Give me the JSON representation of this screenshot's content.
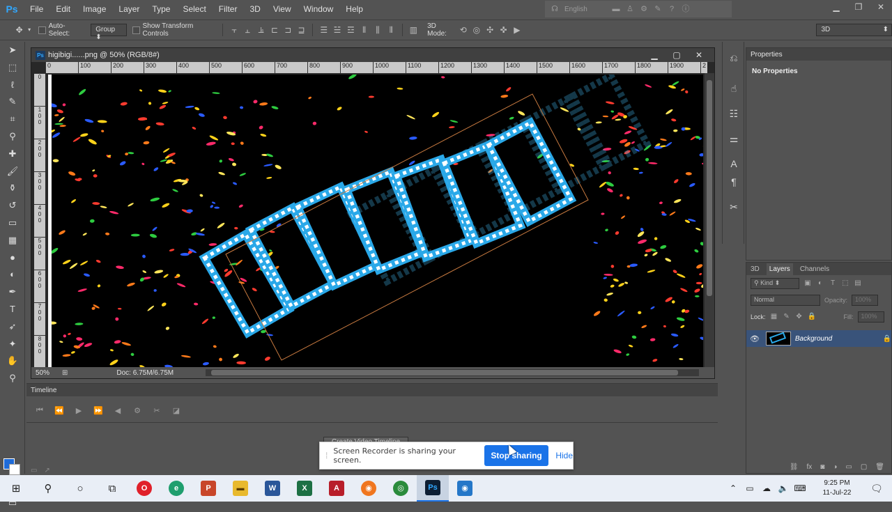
{
  "app": {
    "logo": "Ps"
  },
  "menu": [
    "File",
    "Edit",
    "Image",
    "Layer",
    "Type",
    "Select",
    "Filter",
    "3D",
    "View",
    "Window",
    "Help"
  ],
  "search_bar": {
    "language": "English"
  },
  "options_bar": {
    "auto_select_label": "Auto-Select:",
    "auto_select_value": "Group",
    "transform_label": "Show Transform Controls",
    "mode_3d_label": "3D Mode:",
    "workspace": "3D"
  },
  "document": {
    "title": "higibigi......png @ 50% (RGB/8#)",
    "zoom": "50%",
    "doc_size": "Doc: 6.75M/6.75M",
    "ruler_h": [
      "0",
      "100",
      "200",
      "300",
      "400",
      "500",
      "600",
      "700",
      "800",
      "900",
      "1000",
      "1100",
      "1200",
      "1300",
      "1400",
      "1500",
      "1600",
      "1700",
      "1800",
      "1900",
      "2"
    ],
    "ruler_v": [
      "0",
      "1\n0\n0",
      "2\n0\n0",
      "3\n0\n0",
      "4\n0\n0",
      "5\n0\n0",
      "6\n0\n0",
      "7\n0\n0",
      "8\n0\n0"
    ]
  },
  "timeline": {
    "header": "Timeline",
    "create_button": "Create Video Timeline"
  },
  "recorder": {
    "message": "Screen Recorder is sharing your screen.",
    "stop_label": "Stop sharing",
    "hide_label": "Hide",
    "accent": "#1a73e8"
  },
  "properties": {
    "tab": "Properties",
    "empty": "No Properties"
  },
  "layers": {
    "tabs": [
      "3D",
      "Layers",
      "Channels"
    ],
    "kind_filter": "Kind",
    "blend_mode": "Normal",
    "opacity_label": "Opacity:",
    "opacity_value": "100%",
    "lock_label": "Lock:",
    "fill_label": "Fill:",
    "fill_value": "100%",
    "items": [
      {
        "name": "Background"
      }
    ]
  },
  "colors": {
    "foreground": "#1e6bd8",
    "background": "#ffffff"
  },
  "taskbar": {
    "time": "9:25 PM",
    "date": "11-Jul-22"
  }
}
